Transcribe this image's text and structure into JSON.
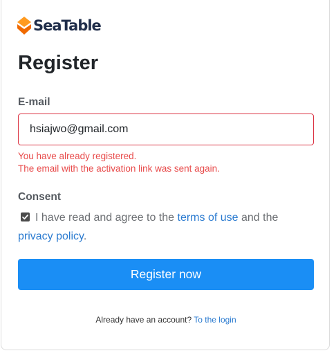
{
  "brand": {
    "name": "SeaTable",
    "logo_icon": "seatable-logo-icon",
    "logo_color": "#ff8000",
    "text_color": "#1f2d4a"
  },
  "page": {
    "title": "Register"
  },
  "email": {
    "label": "E-mail",
    "value": "hsiajwo@gmail.com",
    "border_color": "#dc3545"
  },
  "error": {
    "line1": "You have already registered.",
    "line2": "The email with the activation link was sent again.",
    "color": "#e84a4a"
  },
  "consent": {
    "label": "Consent",
    "checked": true,
    "text_before": "I have read and agree to the",
    "terms_link": "terms of use",
    "text_middle": "and the",
    "privacy_link": "privacy policy",
    "text_after": "."
  },
  "actions": {
    "register_label": "Register now",
    "button_color": "#1a8ef5"
  },
  "footer": {
    "prompt": "Already have an account?",
    "login_link": "To the login"
  }
}
